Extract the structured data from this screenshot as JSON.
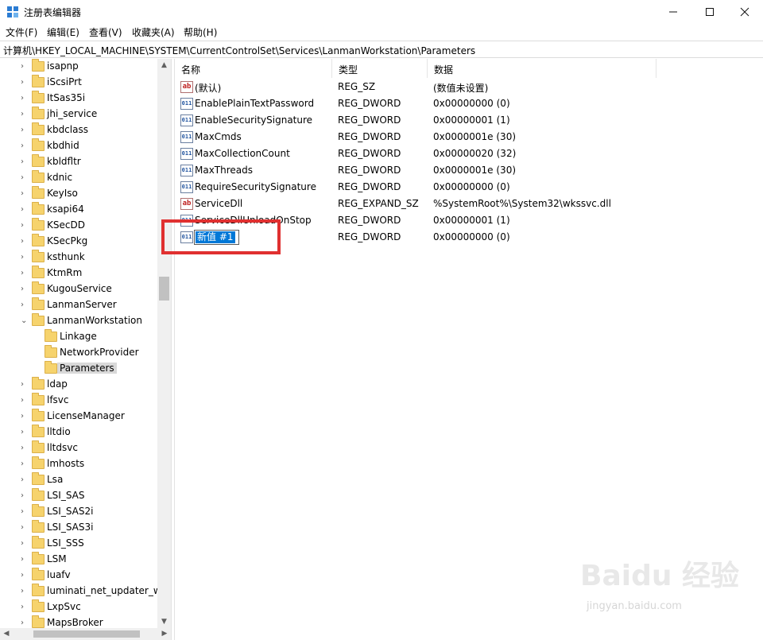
{
  "window": {
    "title": "注册表编辑器"
  },
  "menu": [
    "文件(F)",
    "编辑(E)",
    "查看(V)",
    "收藏夹(A)",
    "帮助(H)"
  ],
  "address": "计算机\\HKEY_LOCAL_MACHINE\\SYSTEM\\CurrentControlSet\\Services\\LanmanWorkstation\\Parameters",
  "tree": [
    {
      "label": "isapnp",
      "level": 1,
      "expander": "collapsed"
    },
    {
      "label": "iScsiPrt",
      "level": 1,
      "expander": "collapsed"
    },
    {
      "label": "ItSas35i",
      "level": 1,
      "expander": "collapsed"
    },
    {
      "label": "jhi_service",
      "level": 1,
      "expander": "collapsed"
    },
    {
      "label": "kbdclass",
      "level": 1,
      "expander": "collapsed"
    },
    {
      "label": "kbdhid",
      "level": 1,
      "expander": "collapsed"
    },
    {
      "label": "kbldfltr",
      "level": 1,
      "expander": "collapsed"
    },
    {
      "label": "kdnic",
      "level": 1,
      "expander": "collapsed"
    },
    {
      "label": "KeyIso",
      "level": 1,
      "expander": "collapsed"
    },
    {
      "label": "ksapi64",
      "level": 1,
      "expander": "collapsed"
    },
    {
      "label": "KSecDD",
      "level": 1,
      "expander": "collapsed"
    },
    {
      "label": "KSecPkg",
      "level": 1,
      "expander": "collapsed"
    },
    {
      "label": "ksthunk",
      "level": 1,
      "expander": "collapsed"
    },
    {
      "label": "KtmRm",
      "level": 1,
      "expander": "collapsed"
    },
    {
      "label": "KugouService",
      "level": 1,
      "expander": "collapsed"
    },
    {
      "label": "LanmanServer",
      "level": 1,
      "expander": "collapsed"
    },
    {
      "label": "LanmanWorkstation",
      "level": 1,
      "expander": "expanded"
    },
    {
      "label": "Linkage",
      "level": 2,
      "expander": "none"
    },
    {
      "label": "NetworkProvider",
      "level": 2,
      "expander": "none"
    },
    {
      "label": "Parameters",
      "level": 2,
      "expander": "none",
      "selected": true
    },
    {
      "label": "ldap",
      "level": 1,
      "expander": "collapsed"
    },
    {
      "label": "lfsvc",
      "level": 1,
      "expander": "collapsed"
    },
    {
      "label": "LicenseManager",
      "level": 1,
      "expander": "collapsed"
    },
    {
      "label": "lltdio",
      "level": 1,
      "expander": "collapsed"
    },
    {
      "label": "lltdsvc",
      "level": 1,
      "expander": "collapsed"
    },
    {
      "label": "lmhosts",
      "level": 1,
      "expander": "collapsed"
    },
    {
      "label": "Lsa",
      "level": 1,
      "expander": "collapsed"
    },
    {
      "label": "LSI_SAS",
      "level": 1,
      "expander": "collapsed"
    },
    {
      "label": "LSI_SAS2i",
      "level": 1,
      "expander": "collapsed"
    },
    {
      "label": "LSI_SAS3i",
      "level": 1,
      "expander": "collapsed"
    },
    {
      "label": "LSI_SSS",
      "level": 1,
      "expander": "collapsed"
    },
    {
      "label": "LSM",
      "level": 1,
      "expander": "collapsed"
    },
    {
      "label": "luafv",
      "level": 1,
      "expander": "collapsed"
    },
    {
      "label": "luminati_net_updater_wi",
      "level": 1,
      "expander": "collapsed"
    },
    {
      "label": "LxpSvc",
      "level": 1,
      "expander": "collapsed"
    },
    {
      "label": "MapsBroker",
      "level": 1,
      "expander": "collapsed"
    }
  ],
  "columns": {
    "name": "名称",
    "type": "类型",
    "data": "数据"
  },
  "values": [
    {
      "name": "(默认)",
      "type": "REG_SZ",
      "data": "(数值未设置)",
      "icon": "string"
    },
    {
      "name": "EnablePlainTextPassword",
      "type": "REG_DWORD",
      "data": "0x00000000 (0)",
      "icon": "binary"
    },
    {
      "name": "EnableSecuritySignature",
      "type": "REG_DWORD",
      "data": "0x00000001 (1)",
      "icon": "binary"
    },
    {
      "name": "MaxCmds",
      "type": "REG_DWORD",
      "data": "0x0000001e (30)",
      "icon": "binary"
    },
    {
      "name": "MaxCollectionCount",
      "type": "REG_DWORD",
      "data": "0x00000020 (32)",
      "icon": "binary"
    },
    {
      "name": "MaxThreads",
      "type": "REG_DWORD",
      "data": "0x0000001e (30)",
      "icon": "binary"
    },
    {
      "name": "RequireSecuritySignature",
      "type": "REG_DWORD",
      "data": "0x00000000 (0)",
      "icon": "binary"
    },
    {
      "name": "ServiceDll",
      "type": "REG_EXPAND_SZ",
      "data": "%SystemRoot%\\System32\\wkssvc.dll",
      "icon": "string"
    },
    {
      "name": "ServiceDllUnloadOnStop",
      "type": "REG_DWORD",
      "data": "0x00000001 (1)",
      "icon": "binary"
    },
    {
      "name": "",
      "type": "REG_DWORD",
      "data": "0x00000000 (0)",
      "icon": "binary",
      "editing": true
    }
  ],
  "editing_value": "新值 #1",
  "watermark": {
    "brand": "Baidu 经验",
    "url": "jingyan.baidu.com"
  },
  "accent": "#0078d7",
  "highlight_color": "#e03030"
}
